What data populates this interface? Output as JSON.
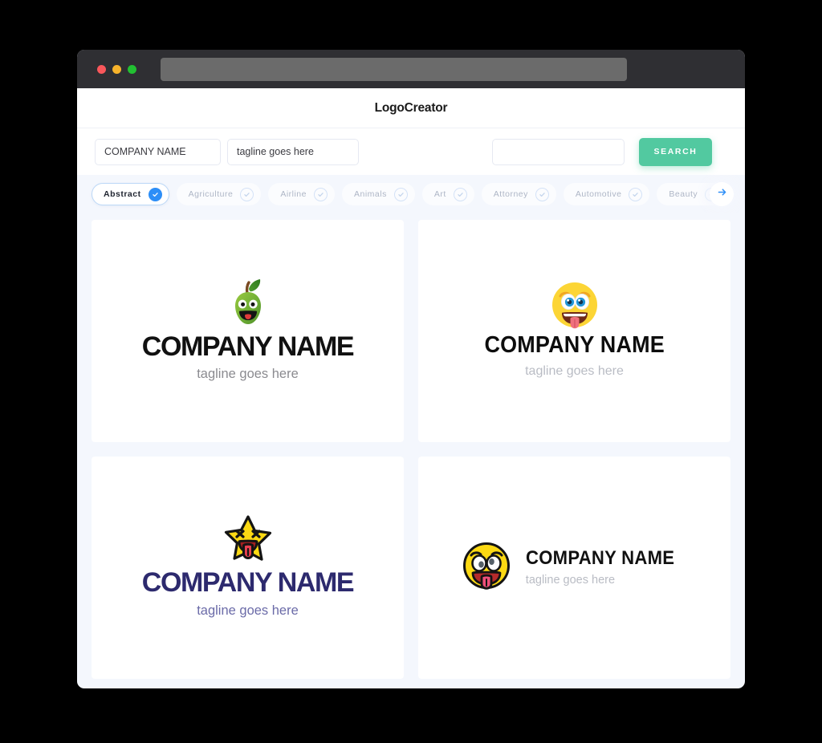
{
  "window": {
    "traffic_lights": [
      {
        "name": "close",
        "color": "#f9575b"
      },
      {
        "name": "minimize",
        "color": "#f7b32b"
      },
      {
        "name": "maximize",
        "color": "#22c032"
      }
    ],
    "url_value": ""
  },
  "header": {
    "brand": "LogoCreator"
  },
  "search": {
    "company_value": "COMPANY NAME",
    "company_placeholder": "COMPANY NAME",
    "tagline_value": "tagline goes here",
    "tagline_placeholder": "tagline goes here",
    "keyword_value": "",
    "keyword_placeholder": "",
    "button_label": "SEARCH",
    "button_color": "#52c9a0"
  },
  "categories": {
    "selected": "Abstract",
    "accent_color": "#2d8ef7",
    "scroll_next_icon": "arrow-right-icon",
    "items": [
      {
        "label": "Abstract",
        "selected": true
      },
      {
        "label": "Agriculture",
        "selected": false
      },
      {
        "label": "Airline",
        "selected": false
      },
      {
        "label": "Animals",
        "selected": false
      },
      {
        "label": "Art",
        "selected": false
      },
      {
        "label": "Attorney",
        "selected": false
      },
      {
        "label": "Automotive",
        "selected": false
      },
      {
        "label": "Beauty",
        "selected": false
      }
    ]
  },
  "results": [
    {
      "icon": "smiling-apple-icon",
      "company_name": "COMPANY NAME",
      "tagline": "tagline goes here",
      "name_color": "#111111",
      "tagline_color": "#8b8b90",
      "layout": "stacked"
    },
    {
      "icon": "smiley-tongue-face-icon",
      "company_name": "COMPANY NAME",
      "tagline": "tagline goes here",
      "name_color": "#0d0d0d",
      "tagline_color": "#b9bcc4",
      "layout": "stacked"
    },
    {
      "icon": "star-tongue-icon",
      "company_name": "COMPANY NAME",
      "tagline": "tagline goes here",
      "name_color": "#2d2a6e",
      "tagline_color": "#6b6ba8",
      "layout": "stacked"
    },
    {
      "icon": "crazy-face-tongue-icon",
      "company_name": "COMPANY NAME",
      "tagline": "tagline goes here",
      "name_color": "#111111",
      "tagline_color": "#b9bcc4",
      "layout": "horizontal"
    }
  ]
}
